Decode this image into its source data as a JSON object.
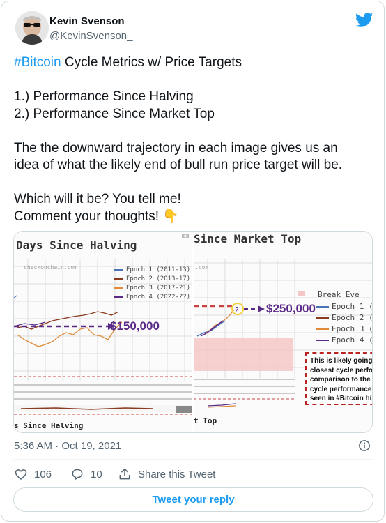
{
  "author": {
    "name": "Kevin Svenson",
    "handle": "@KevinSvenson_"
  },
  "tweet": {
    "hashtag": "#Bitcoin",
    "line1_rest": " Cycle Metrics w/ Price Targets",
    "line2": "1.) Performance Since Halving",
    "line3": "2.) Performance Since Market Top",
    "line4": "The the downward trajectory in each image gives us an",
    "line5": "idea of what the likely end of bull run price target will be.",
    "line6": "Which will it be? You tell me!",
    "line7": "Comment your thoughts! 👇"
  },
  "media": {
    "left": {
      "title": "Days Since Halving",
      "watermark": "checkonchain.com",
      "footer": "s Since Halving",
      "target": "$150,000",
      "legend": [
        "Epoch 1 (2011-13)",
        "Epoch 2 (2013-17)",
        "Epoch 3 (2017-21)",
        "Epoch 4 (2022-??)"
      ]
    },
    "right": {
      "title": "Since Market Top",
      "watermark": ".com",
      "footer": "t Top",
      "target": "$250,000",
      "legend": [
        "Break Eve",
        "Epoch 1 (",
        "Epoch 2 (",
        "Epoch 3 (",
        "Epoch 4 ("
      ],
      "note": [
        "This is likely going t",
        "closest cycle perfor",
        "comparison to the p",
        "cycle performance",
        "seen in #Bitcoin hist"
      ]
    }
  },
  "meta": {
    "timestamp": "5:36 AM · Oct 19, 2021"
  },
  "actions": {
    "likes": "106",
    "replies": "10",
    "share": "Share this Tweet",
    "reply_button": "Tweet your reply"
  },
  "colors": {
    "accent": "#1d9bf0",
    "epoch1": "#4a73b8",
    "epoch2": "#8b3a1e",
    "epoch3": "#e08a3a",
    "epoch4": "#5b2a86",
    "breakeven": "#f4c7c7"
  },
  "icons": {
    "brand": "twitter-bird-icon",
    "info": "info-icon",
    "like": "heart-icon",
    "reply": "comment-icon",
    "share": "share-icon"
  }
}
